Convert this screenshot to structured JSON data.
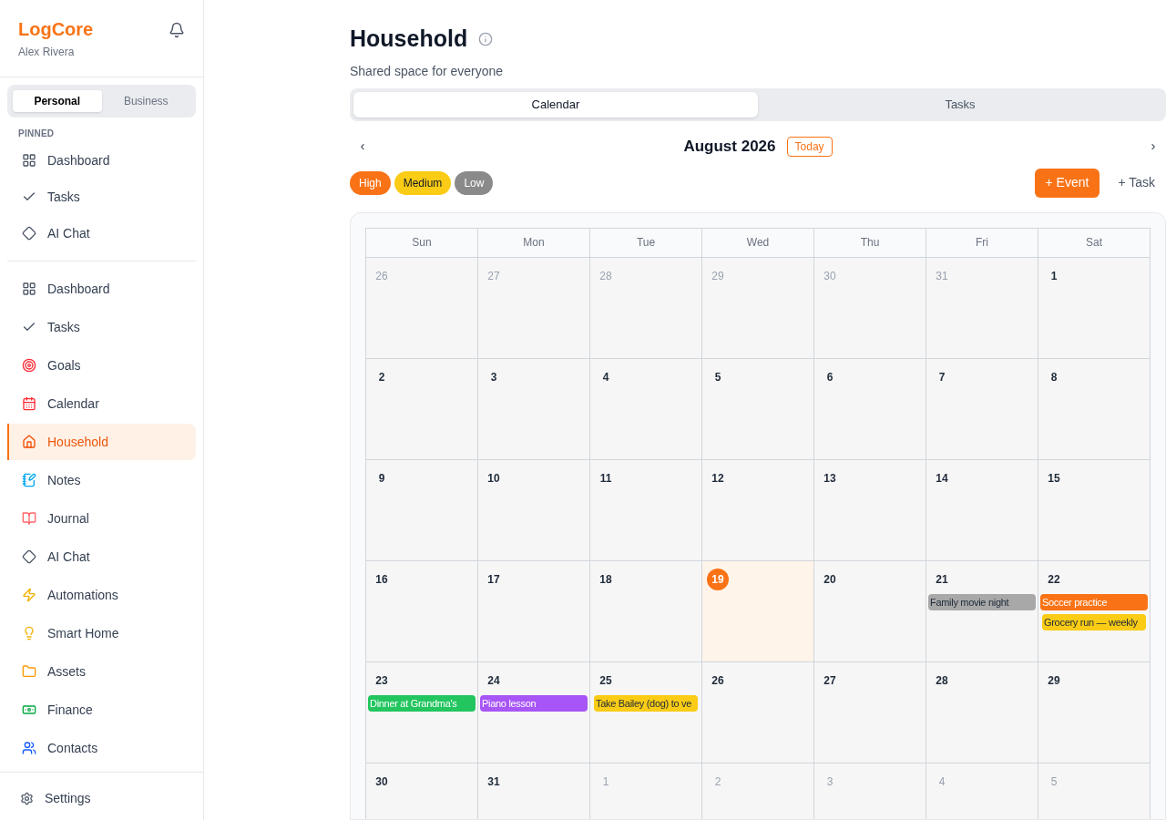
{
  "app": {
    "logo": "LogCore",
    "user": "Alex Rivera"
  },
  "mode_tabs": [
    {
      "label": "Personal",
      "selected": true
    },
    {
      "label": "Business",
      "selected": false
    }
  ],
  "pinned": {
    "heading": "PINNED",
    "items": [
      {
        "label": "Dashboard",
        "kind": "grid",
        "selected": false
      },
      {
        "label": "Tasks",
        "kind": "check",
        "selected": false
      },
      {
        "label": "AI Chat",
        "kind": "diamond",
        "selected": false
      }
    ]
  },
  "nav": [
    {
      "label": "Dashboard",
      "kind": "grid",
      "selected": false
    },
    {
      "label": "Tasks",
      "kind": "check",
      "selected": false
    },
    {
      "label": "Goals",
      "kind": "target",
      "selected": false
    },
    {
      "label": "Calendar",
      "kind": "calendar",
      "selected": false
    },
    {
      "label": "Household",
      "kind": "home",
      "selected": true
    },
    {
      "label": "Notes",
      "kind": "note",
      "selected": false
    },
    {
      "label": "Journal",
      "kind": "book",
      "selected": false
    },
    {
      "label": "AI Chat",
      "kind": "diamond",
      "selected": false
    },
    {
      "label": "Automations",
      "kind": "zap",
      "selected": false
    },
    {
      "label": "Smart Home",
      "kind": "bulb",
      "selected": false
    },
    {
      "label": "Assets",
      "kind": "folder",
      "selected": false
    },
    {
      "label": "Finance",
      "kind": "money",
      "selected": false
    },
    {
      "label": "Contacts",
      "kind": "users",
      "selected": false
    }
  ],
  "settings": {
    "label": "Settings"
  },
  "page": {
    "title": "Household",
    "subtitle": "Shared space for everyone"
  },
  "view_tabs": [
    {
      "label": "Calendar",
      "selected": true
    },
    {
      "label": "Tasks",
      "selected": false
    }
  ],
  "month": {
    "title": "August 2026",
    "today": "Today",
    "prev": "‹",
    "next": "›"
  },
  "priorities": [
    {
      "label": "High",
      "color": "#f97316"
    },
    {
      "label": "Medium",
      "color": "#facc15"
    },
    {
      "label": "Low",
      "color": "#8a8a8a"
    }
  ],
  "add_event": "+ Event",
  "add_task": "+ Task",
  "weekdays": [
    "Sun",
    "Mon",
    "Tue",
    "Wed",
    "Thu",
    "Fri",
    "Sat"
  ],
  "days": [
    {
      "label": "26",
      "in_month": false,
      "selected": false
    },
    {
      "label": "27",
      "in_month": false,
      "selected": false
    },
    {
      "label": "28",
      "in_month": false,
      "selected": false
    },
    {
      "label": "29",
      "in_month": false,
      "selected": false
    },
    {
      "label": "30",
      "in_month": false,
      "selected": false
    },
    {
      "label": "31",
      "in_month": false,
      "selected": false
    },
    {
      "label": "1",
      "in_month": true,
      "selected": false
    },
    {
      "label": "2",
      "in_month": true,
      "selected": false
    },
    {
      "label": "3",
      "in_month": true,
      "selected": false
    },
    {
      "label": "4",
      "in_month": true,
      "selected": false
    },
    {
      "label": "5",
      "in_month": true,
      "selected": false
    },
    {
      "label": "6",
      "in_month": true,
      "selected": false
    },
    {
      "label": "7",
      "in_month": true,
      "selected": false
    },
    {
      "label": "8",
      "in_month": true,
      "selected": false
    },
    {
      "label": "9",
      "in_month": true,
      "selected": false
    },
    {
      "label": "10",
      "in_month": true,
      "selected": false
    },
    {
      "label": "11",
      "in_month": true,
      "selected": false
    },
    {
      "label": "12",
      "in_month": true,
      "selected": false
    },
    {
      "label": "13",
      "in_month": true,
      "selected": false
    },
    {
      "label": "14",
      "in_month": true,
      "selected": false
    },
    {
      "label": "15",
      "in_month": true,
      "selected": false
    },
    {
      "label": "16",
      "in_month": true,
      "selected": false
    },
    {
      "label": "17",
      "in_month": true,
      "selected": false
    },
    {
      "label": "18",
      "in_month": true,
      "selected": false
    },
    {
      "label": "19",
      "in_month": true,
      "selected": true
    },
    {
      "label": "20",
      "in_month": true,
      "selected": false
    },
    {
      "label": "21",
      "in_month": true,
      "selected": false,
      "events": [
        {
          "title": "Family movie night",
          "kind": "event",
          "color": "#a8a8a8"
        }
      ]
    },
    {
      "label": "22",
      "in_month": true,
      "selected": false,
      "events": [
        {
          "title": "Soccer practice",
          "kind": "event",
          "color": "#f97316"
        },
        {
          "title": "Grocery run — weekly",
          "kind": "task",
          "color": "#facc15"
        }
      ]
    },
    {
      "label": "23",
      "in_month": true,
      "selected": false,
      "events": [
        {
          "title": "Dinner at Grandma's",
          "kind": "event",
          "color": "#22c55e"
        }
      ]
    },
    {
      "label": "24",
      "in_month": true,
      "selected": false,
      "events": [
        {
          "title": "Piano lesson",
          "kind": "event",
          "color": "#a855f7"
        }
      ]
    },
    {
      "label": "25",
      "in_month": true,
      "selected": false,
      "events": [
        {
          "title": "Take Bailey (dog) to ve",
          "kind": "task",
          "color": "#facc15"
        }
      ]
    },
    {
      "label": "26",
      "in_month": true,
      "selected": false
    },
    {
      "label": "27",
      "in_month": true,
      "selected": false
    },
    {
      "label": "28",
      "in_month": true,
      "selected": false
    },
    {
      "label": "29",
      "in_month": true,
      "selected": false
    },
    {
      "label": "30",
      "in_month": true,
      "selected": false
    },
    {
      "label": "31",
      "in_month": true,
      "selected": false
    },
    {
      "label": "1",
      "in_month": false,
      "selected": false
    },
    {
      "label": "2",
      "in_month": false,
      "selected": false
    },
    {
      "label": "3",
      "in_month": false,
      "selected": false
    },
    {
      "label": "4",
      "in_month": false,
      "selected": false
    },
    {
      "label": "5",
      "in_month": false,
      "selected": false
    }
  ]
}
